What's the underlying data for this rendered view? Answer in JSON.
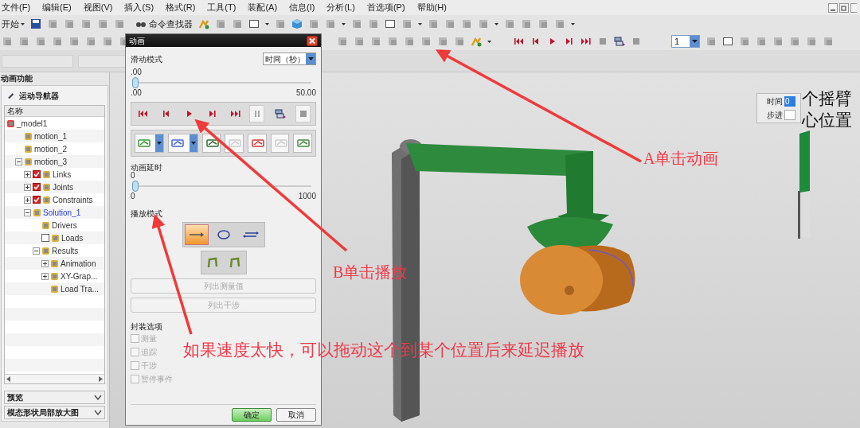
{
  "menu": [
    "文件(F)",
    "编辑(E)",
    "视图(V)",
    "插入(S)",
    "格式(R)",
    "工具(T)",
    "装配(A)",
    "信息(I)",
    "分析(L)",
    "首选项(P)",
    "帮助(H)"
  ],
  "toolbar": {
    "start": "开始",
    "command_finder": "命令查找器",
    "frame_field": "1"
  },
  "navigator": {
    "title": "动画功能",
    "header": "运动导航器",
    "column": "名称",
    "tree": [
      {
        "label": "_model1",
        "children": [
          {
            "label": "motion_1"
          },
          {
            "label": "motion_2"
          },
          {
            "label": "motion_3",
            "expanded": true,
            "children": [
              {
                "label": "Links",
                "expanded": false,
                "checked": true
              },
              {
                "label": "Joints",
                "expanded": false,
                "checked": true
              },
              {
                "label": "Constraints",
                "expanded": false,
                "checked": true
              },
              {
                "label": "Solution_1",
                "expanded": true,
                "active": true,
                "children": [
                  {
                    "label": "Drivers"
                  },
                  {
                    "label": "Loads",
                    "checked": false
                  },
                  {
                    "label": "Results",
                    "expanded": true,
                    "children": [
                      {
                        "label": "Animation",
                        "expanded": false
                      },
                      {
                        "label": "XY-Grap...",
                        "expanded": false
                      },
                      {
                        "label": "Load Tra..."
                      }
                    ]
                  }
                ]
              }
            ]
          }
        ]
      }
    ],
    "panels": [
      {
        "label": "预览",
        "expanded": false
      },
      {
        "label": "模态形状局部放大图",
        "expanded": false
      }
    ]
  },
  "dialog": {
    "title": "动画",
    "slide_mode": {
      "label": "滑动模式",
      "value": "时间（秒）"
    },
    "time_slider": {
      "reading": ".00",
      "level": 0,
      "min": ".00",
      "max": "50.00"
    },
    "delay": {
      "label": "动画延时",
      "reading": "0",
      "level": 0,
      "min": "0",
      "max": "1000"
    },
    "play_mode": {
      "label": "播放模式",
      "options": [
        {
          "selected": true
        },
        {
          "selected": false
        },
        {
          "selected": false
        }
      ]
    },
    "list_buttons": [
      {
        "label": "列出测量值",
        "disabled": true
      },
      {
        "label": "列出干涉",
        "disabled": true
      }
    ],
    "packaging": {
      "label": "封装选项",
      "options": [
        {
          "label": "测量",
          "checked": false
        },
        {
          "label": "追踪",
          "checked": false
        },
        {
          "label": "干涉",
          "checked": false
        },
        {
          "label": "暂停事件",
          "checked": false
        }
      ]
    },
    "buttons": [
      "确定",
      "取消"
    ]
  },
  "timer": {
    "time_label": "时间",
    "time_value": "0",
    "step_label": "步进"
  },
  "overlay_text": [
    "个摇臂",
    "心位置"
  ],
  "annotations": [
    "A单击动画",
    "B单击播放",
    "如果速度太快，可以拖动这个到某个位置后来延迟播放"
  ]
}
